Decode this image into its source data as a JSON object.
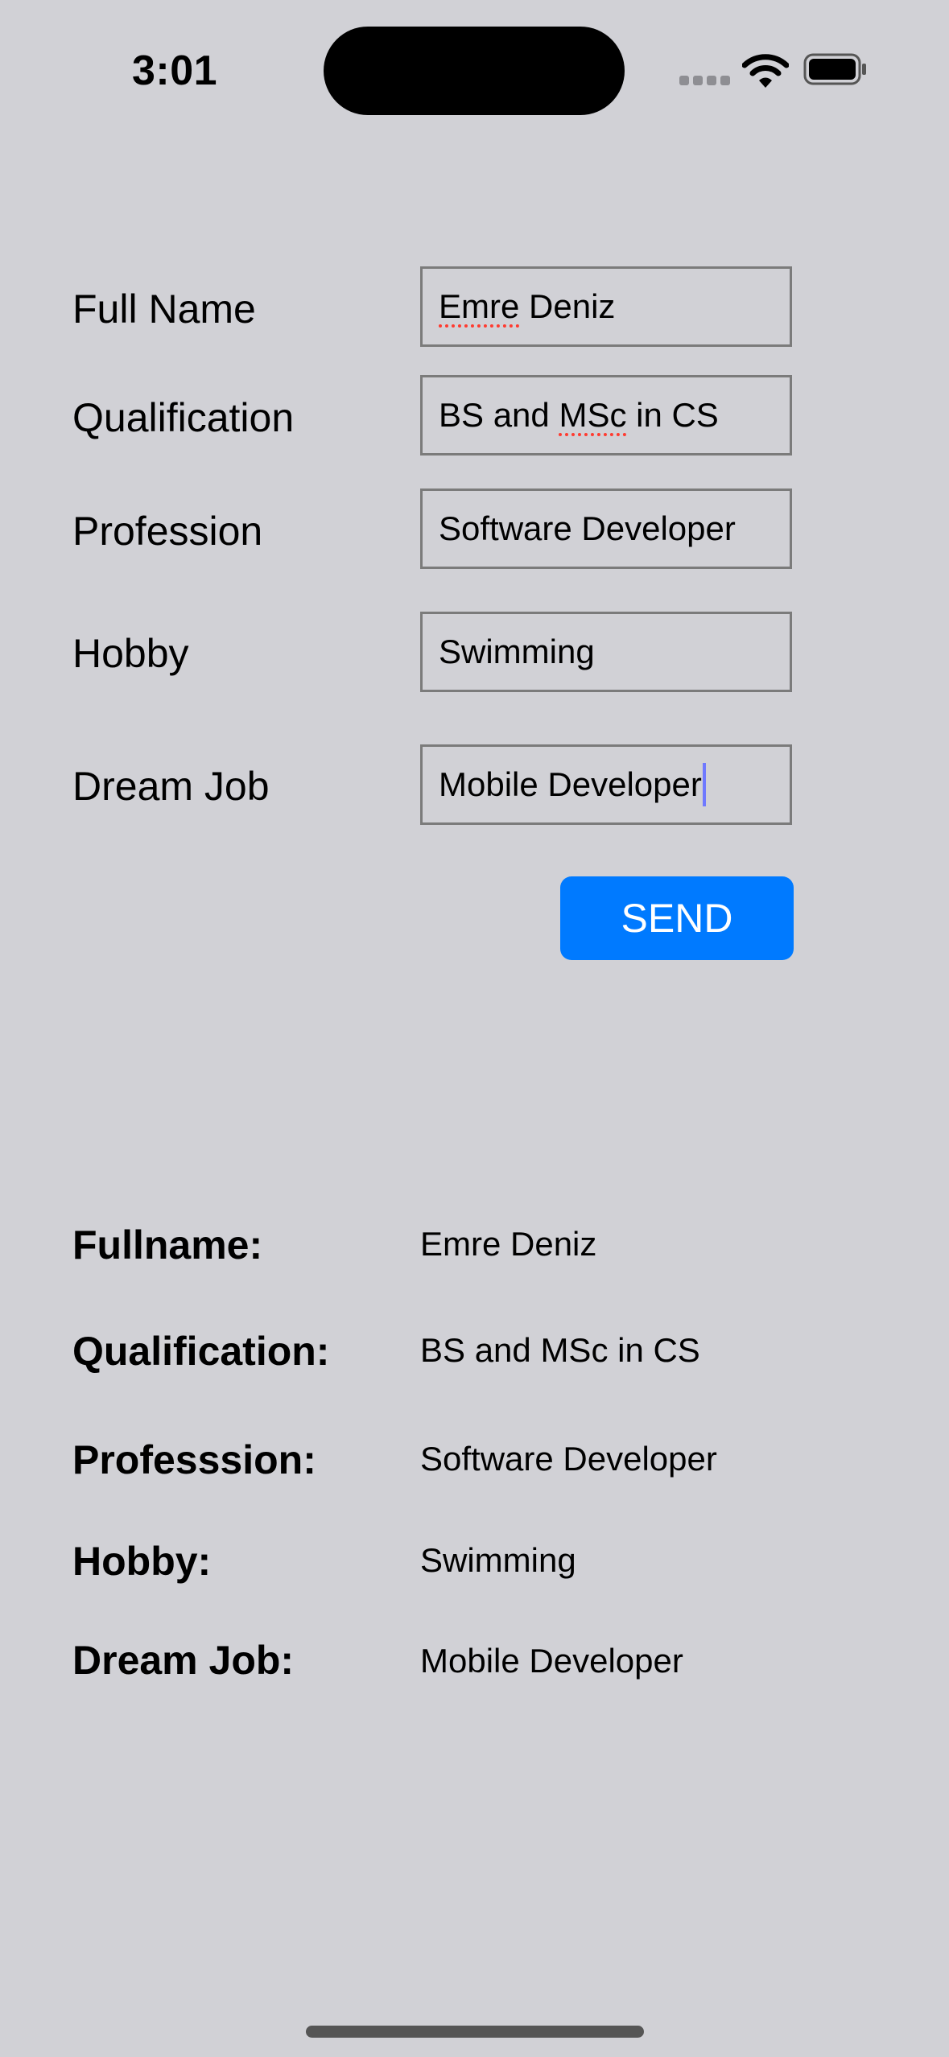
{
  "status_bar": {
    "time": "3:01"
  },
  "form": {
    "full_name": {
      "label": "Full Name",
      "value": "Emre Deniz"
    },
    "qualification": {
      "label": "Qualification",
      "value": "BS and MSc in CS"
    },
    "profession": {
      "label": "Profession",
      "value": "Software Developer"
    },
    "hobby": {
      "label": "Hobby",
      "value": "Swimming"
    },
    "dream_job": {
      "label": "Dream Job",
      "value": "Mobile Developer"
    },
    "send_label": "SEND"
  },
  "results": {
    "full_name": {
      "label": "Fullname:",
      "value": "Emre Deniz"
    },
    "qualification": {
      "label": "Qualification:",
      "value": "BS and MSc in CS"
    },
    "profession": {
      "label": "Professsion:",
      "value": "Software Developer"
    },
    "hobby": {
      "label": "Hobby:",
      "value": "Swimming"
    },
    "dream_job": {
      "label": "Dream Job:",
      "value": "Mobile Developer"
    }
  },
  "colors": {
    "background": "#d1d1d6",
    "accent": "#007aff",
    "field_border": "#7b7b7b",
    "spellcheck": "#ff3b30"
  },
  "icons": [
    "cellular-signal-icon",
    "wifi-icon",
    "battery-icon"
  ]
}
